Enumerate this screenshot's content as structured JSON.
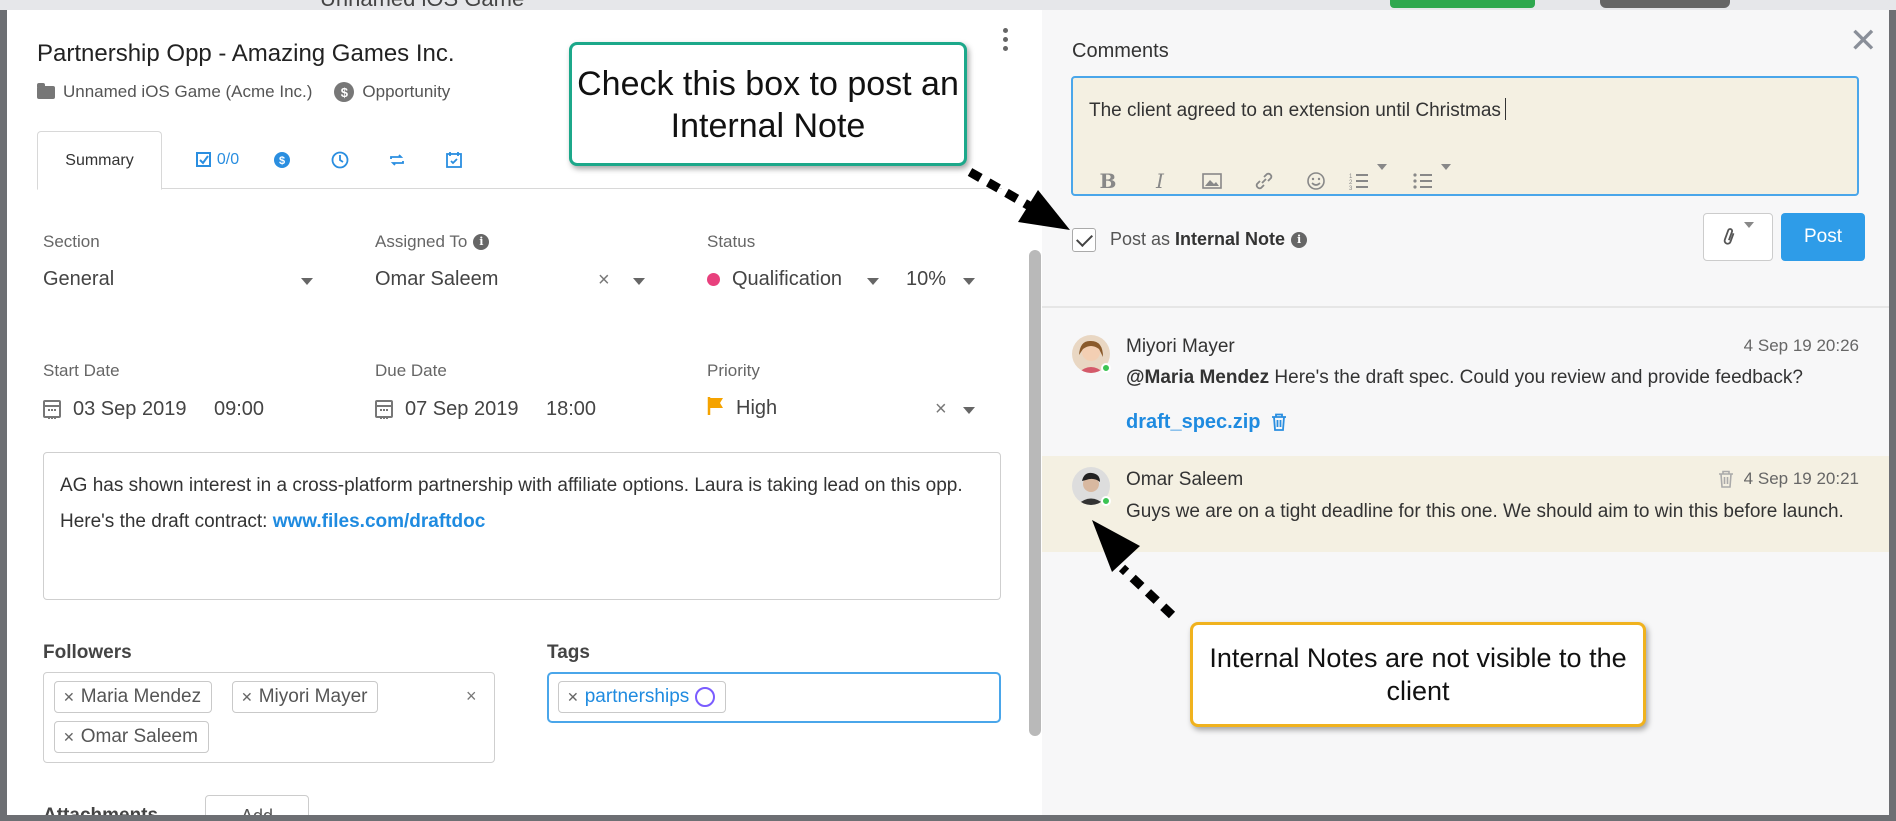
{
  "background": {
    "app_title": "Unnamed iOS Game"
  },
  "header": {
    "title": "Partnership Opp - Amazing Games Inc.",
    "project": "Unnamed iOS Game (Acme Inc.)",
    "type": "Opportunity"
  },
  "tabs": [
    {
      "label": "Summary",
      "icon": "summary"
    },
    {
      "label": "0/0",
      "icon": "checklist-icon"
    },
    {
      "label": "",
      "icon": "dollar-icon"
    },
    {
      "label": "",
      "icon": "clock-icon"
    },
    {
      "label": "",
      "icon": "repeat-icon"
    },
    {
      "label": "",
      "icon": "calendar-check-icon"
    }
  ],
  "fields": {
    "section": {
      "label": "Section",
      "value": "General"
    },
    "assigned": {
      "label": "Assigned To",
      "value": "Omar Saleem"
    },
    "status": {
      "label": "Status",
      "value": "Qualification",
      "percent": "10%",
      "dot_color": "#e8407d"
    },
    "start": {
      "label": "Start Date",
      "date": "03 Sep 2019",
      "time": "09:00"
    },
    "due": {
      "label": "Due Date",
      "date": "07 Sep 2019",
      "time": "18:00"
    },
    "priority": {
      "label": "Priority",
      "value": "High",
      "flag_color": "#f5a300"
    }
  },
  "description": {
    "line1": "AG has shown interest in a cross-platform partnership with affiliate options. Laura is taking lead on this opp.",
    "line2_prefix": "Here's the draft contract: ",
    "link": "www.files.com/draftdoc"
  },
  "followers": {
    "label": "Followers",
    "items": [
      "Maria Mendez",
      "Miyori Mayer",
      "Omar Saleem"
    ]
  },
  "tags": {
    "label": "Tags",
    "items": [
      "partnerships"
    ]
  },
  "attachments": {
    "label": "Attachments",
    "add_label": "Add"
  },
  "comments": {
    "title": "Comments",
    "draft": "The client agreed to an extension until Christmas",
    "internal_note_prefix": "Post as ",
    "internal_note_bold": "Internal Note",
    "internal_note_checked": true,
    "post_label": "Post",
    "list": [
      {
        "author": "Miyori Mayer",
        "time": "4 Sep 19 20:26",
        "mention": "@Maria Mendez",
        "text": " Here's the draft spec. Could you review and provide feedback?",
        "file": "draft_spec.zip"
      },
      {
        "author": "Omar Saleem",
        "time": "4 Sep 19 20:21",
        "text": "Guys we are on a tight deadline for this one. We should aim to win this before launch.",
        "internal": true
      }
    ]
  },
  "callouts": {
    "checkbox_hint": "Check this box to post an Internal Note",
    "internal_hint": "Internal Notes are not visible to the client"
  },
  "colors": {
    "accent": "#2e9ce8",
    "internal_bg": "#f4f0e2",
    "callout_green": "#1ca88a",
    "callout_orange": "#f0b21e"
  }
}
